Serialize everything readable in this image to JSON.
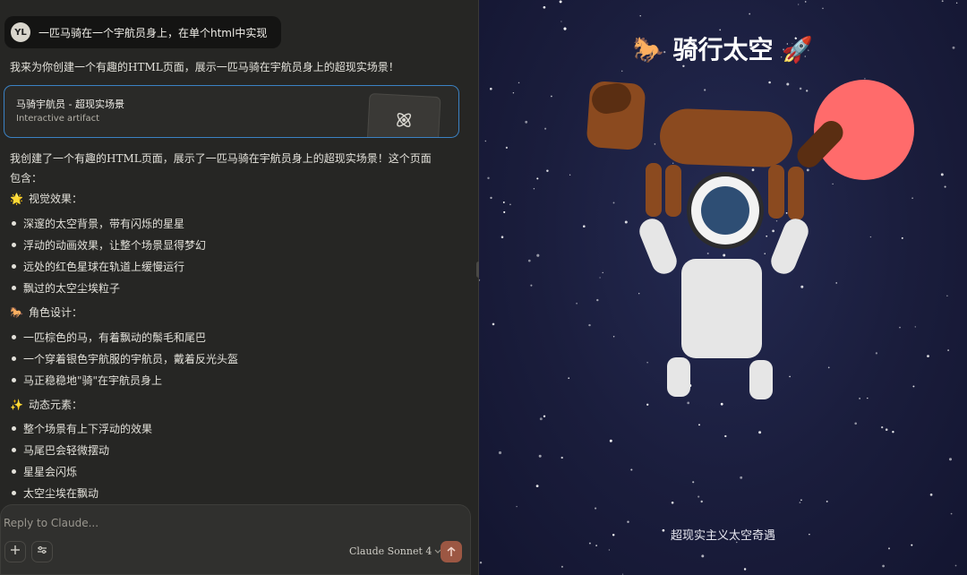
{
  "chat": {
    "user": {
      "initials": "YL",
      "message": "一匹马骑在一个宇航员身上，在单个html中实现"
    },
    "intro": "我来为你创建一个有趣的HTML页面，展示一匹马骑在宇航员身上的超现实场景！",
    "artifact": {
      "title": "马骑宇航员 - 超现实场景",
      "subtitle": "Interactive artifact",
      "icon": "atom-icon"
    },
    "summary": "我创建了一个有趣的HTML页面，展示了一匹马骑在宇航员身上的超现实场景！这个页面包含：",
    "sections": [
      {
        "emoji": "🌟",
        "title": "视觉效果：",
        "items": [
          "深邃的太空背景，带有闪烁的星星",
          "浮动的动画效果，让整个场景显得梦幻",
          "远处的红色星球在轨道上缓慢运行",
          "飘过的太空尘埃粒子"
        ]
      },
      {
        "emoji": "🐎",
        "title": "角色设计：",
        "items": [
          "一匹棕色的马，有着飘动的鬃毛和尾巴",
          "一个穿着银色宇航服的宇航员，戴着反光头盔",
          "马正稳稳地\"骑\"在宇航员身上"
        ]
      },
      {
        "emoji": "✨",
        "title": "动态元素：",
        "items": [
          "整个场景有上下浮动的效果",
          "马尾巴会轻微摆动",
          "星星会闪烁",
          "太空尘埃在飘动"
        ]
      }
    ]
  },
  "composer": {
    "placeholder": "Reply to Claude...",
    "model": "Claude Sonnet 4",
    "plus_icon": "plus-icon",
    "settings_icon": "sliders-icon",
    "send_icon": "arrow-up-icon"
  },
  "preview": {
    "title": "🐎 骑行太空 🚀",
    "subtitle": "超现实主义太空奇遇",
    "colors": {
      "horse": "#8b4a1f",
      "horse_dark": "#5a2e12",
      "planet": "#ff6b6b",
      "suit": "#e6e6e6",
      "visor": "#2e4e74"
    }
  }
}
